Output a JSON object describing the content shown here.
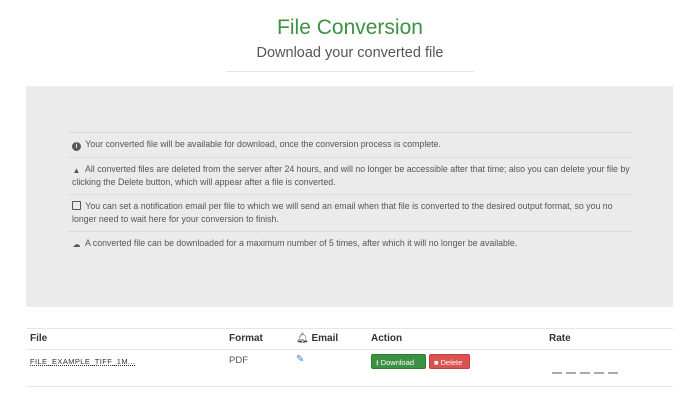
{
  "header": {
    "title": "File Conversion",
    "subtitle": "Download your converted file"
  },
  "info": [
    {
      "icon": "info-circle-icon",
      "glyph": "i",
      "text": "Your converted file will be available for download, once the conversion process is complete."
    },
    {
      "icon": "user-icon",
      "glyph": "▲",
      "text": "All converted files are deleted from the server after 24 hours, and will no longer be accessible after that time; also you can delete your file by clicking the Delete button, which will appear after a file is converted."
    },
    {
      "icon": "envelope-icon",
      "glyph": "▬",
      "text": "You can set a notification email per file to which we will send an email when that file is converted to the desired output format, so you no longer need to wait here for your conversion to finish."
    },
    {
      "icon": "cloud-download-icon",
      "glyph": "☁",
      "text": "A converted file can be downloaded for a maximum number of 5 times, after which it will no longer be available."
    }
  ],
  "table": {
    "headers": {
      "file": "File",
      "format": "Format",
      "email": "Email",
      "action": "Action",
      "rate": "Rate"
    },
    "rows": [
      {
        "file": "FILE_EXAMPLE_TIFF_1M...",
        "format": "PDF",
        "download_label": "Download",
        "delete_label": "Delete",
        "rating": 0,
        "rating_max": 5
      }
    ]
  },
  "colors": {
    "title": "#3d9142",
    "download": "#3d9142",
    "delete": "#d9534f",
    "panel": "#ebebeb",
    "edit_icon": "#3b7ddd"
  }
}
